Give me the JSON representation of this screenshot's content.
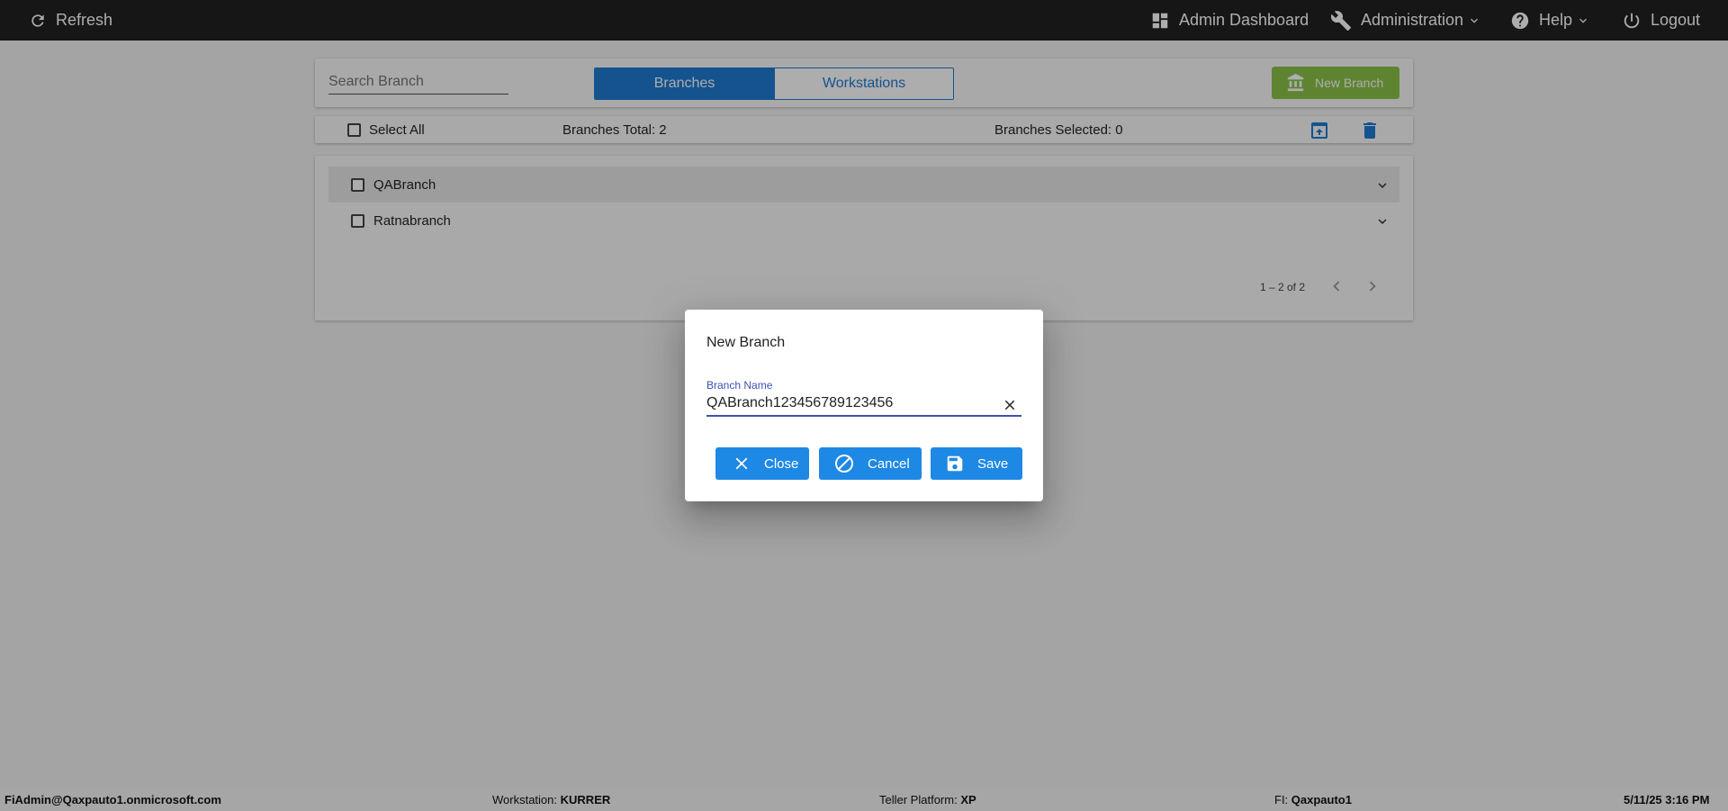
{
  "topbar": {
    "refresh_label": "Refresh",
    "admin_dashboard_label": "Admin Dashboard",
    "administration_label": "Administration",
    "help_label": "Help",
    "logout_label": "Logout"
  },
  "toolbar": {
    "search_placeholder": "Search Branch",
    "tabs": [
      {
        "label": "Branches",
        "active": true
      },
      {
        "label": "Workstations",
        "active": false
      }
    ],
    "new_branch_label": "New Branch"
  },
  "summary": {
    "select_all_label": "Select All",
    "total_text": "Branches Total: 2",
    "selected_text": "Branches Selected: 0"
  },
  "branches": [
    {
      "name": "QABranch"
    },
    {
      "name": "Ratnabranch"
    }
  ],
  "pager": {
    "range_text": "1 – 2 of 2"
  },
  "dialog": {
    "title": "New Branch",
    "field_label": "Branch Name",
    "field_value": "QABranch123456789123456",
    "close_label": "Close",
    "cancel_label": "Cancel",
    "save_label": "Save"
  },
  "statusbar": {
    "user": "FiAdmin@Qaxpauto1.onmicrosoft.com",
    "workstation_label": "Workstation:",
    "workstation_value": "KURRER",
    "platform_label": "Teller Platform:",
    "platform_value": "XP",
    "fi_label": "FI:",
    "fi_value": "Qaxpauto1",
    "datetime": "5/11/25 3:16 PM"
  },
  "colors": {
    "topbar_bg": "#212121",
    "primary": "#1e7bd2",
    "new_branch_green": "#8bc34a",
    "dialog_button": "#1e88e5",
    "field_accent": "#3f51b5"
  }
}
